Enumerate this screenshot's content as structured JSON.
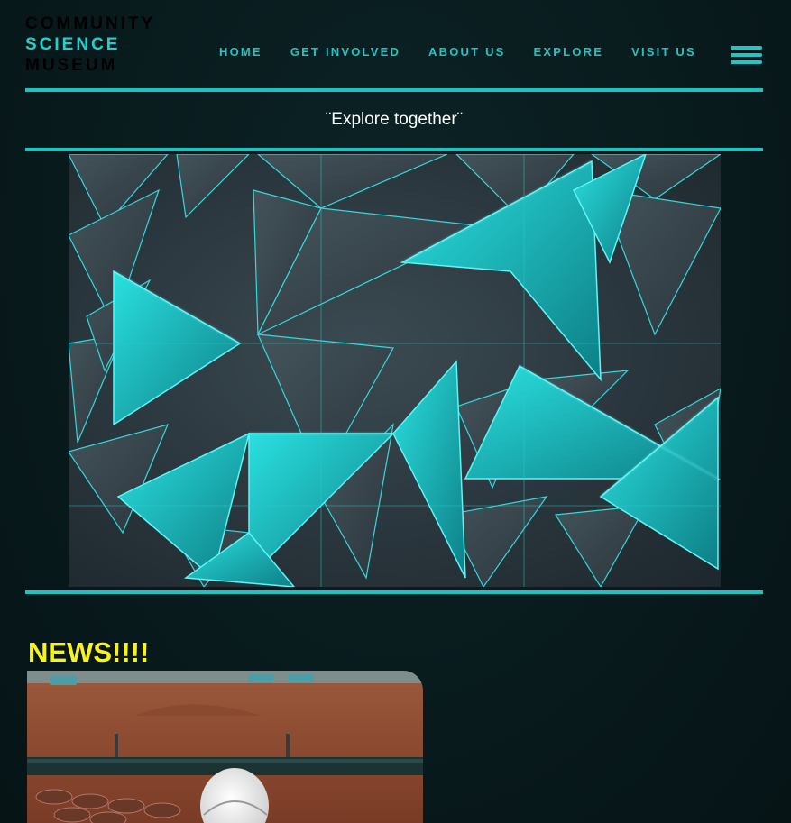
{
  "header": {
    "logo": {
      "line1": "COMMUNITY",
      "line2": "SCIENCE",
      "line3": "MUSEUM"
    },
    "nav": [
      {
        "label": "HOME"
      },
      {
        "label": "GET INVOLVED"
      },
      {
        "label": "ABOUT US"
      },
      {
        "label": "EXPLORE"
      },
      {
        "label": "VISIT US"
      }
    ],
    "menu_icon": "hamburger-menu-icon"
  },
  "tagline": "¨Explore together¨",
  "hero_image": "teal-geometric-triangles-wall",
  "news": {
    "title": "NEWS!!!!",
    "image": "astronaut-helmet-on-dirt-field"
  },
  "colors": {
    "background": "#08191b",
    "accent": "#1ec2bf",
    "news_title": "#f7f220",
    "tagline": "#ffffff"
  }
}
